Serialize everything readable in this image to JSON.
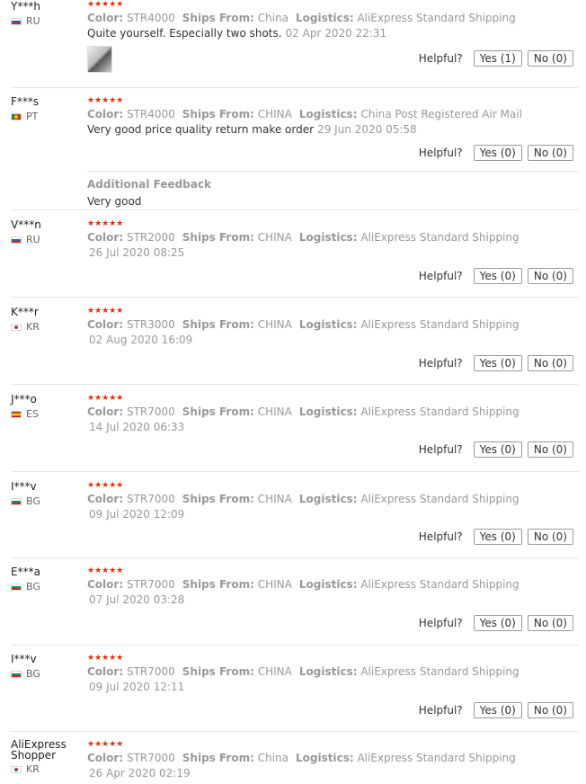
{
  "labels": {
    "color": "Color:",
    "ships_from": "Ships From:",
    "logistics": "Logistics:",
    "helpful": "Helpful?"
  },
  "reviews": [
    {
      "name": "Y***h",
      "country": "RU",
      "stars": "★★★★★",
      "color": "STR4000",
      "ships_from": "China",
      "logistics": "AliExpress Standard Shipping",
      "text": "Quite yourself. Especially two shots.",
      "date": "02 Apr 2020 22:31",
      "yes": "Yes (1)",
      "no": "No (0)"
    },
    {
      "name": "F***s",
      "country": "PT",
      "stars": "★★★★★",
      "color": "STR4000",
      "ships_from": "CHINA",
      "logistics": "China Post Registered Air Mail",
      "text": "Very good price quality return make order",
      "date": "29 Jun 2020 05:58",
      "yes": "Yes (0)",
      "no": "No (0)",
      "additional_title": "Additional Feedback",
      "additional_text": "Very good"
    },
    {
      "name": "V***n",
      "country": "RU",
      "stars": "★★★★★",
      "color": "STR2000",
      "ships_from": "CHINA",
      "logistics": "AliExpress Standard Shipping",
      "date": "26 Jul 2020 08:25",
      "yes": "Yes (0)",
      "no": "No (0)"
    },
    {
      "name": "K***r",
      "country": "KR",
      "stars": "★★★★★",
      "color": "STR3000",
      "ships_from": "CHINA",
      "logistics": "AliExpress Standard Shipping",
      "date": "02 Aug 2020 16:09",
      "yes": "Yes (0)",
      "no": "No (0)"
    },
    {
      "name": "J***o",
      "country": "ES",
      "stars": "★★★★★",
      "color": "STR7000",
      "ships_from": "CHINA",
      "logistics": "AliExpress Standard Shipping",
      "date": "14 Jul 2020 06:33",
      "yes": "Yes (0)",
      "no": "No (0)"
    },
    {
      "name": "I***v",
      "country": "BG",
      "stars": "★★★★★",
      "color": "STR7000",
      "ships_from": "CHINA",
      "logistics": "AliExpress Standard Shipping",
      "date": "09 Jul 2020 12:09",
      "yes": "Yes (0)",
      "no": "No (0)"
    },
    {
      "name": "E***a",
      "country": "BG",
      "stars": "★★★★★",
      "color": "STR7000",
      "ships_from": "CHINA",
      "logistics": "AliExpress Standard Shipping",
      "date": "07 Jul 2020 03:28",
      "yes": "Yes (0)",
      "no": "No (0)"
    },
    {
      "name": "I***v",
      "country": "BG",
      "stars": "★★★★★",
      "color": "STR7000",
      "ships_from": "CHINA",
      "logistics": "AliExpress Standard Shipping",
      "date": "09 Jul 2020 12:11",
      "yes": "Yes (0)",
      "no": "No (0)"
    },
    {
      "name": "AliExpress Shopper",
      "country": "KR",
      "stars": "★★★★★",
      "color": "STR7000",
      "ships_from": "China",
      "logistics": "AliExpress Standard Shipping",
      "date": "26 Apr 2020 02:19"
    }
  ]
}
